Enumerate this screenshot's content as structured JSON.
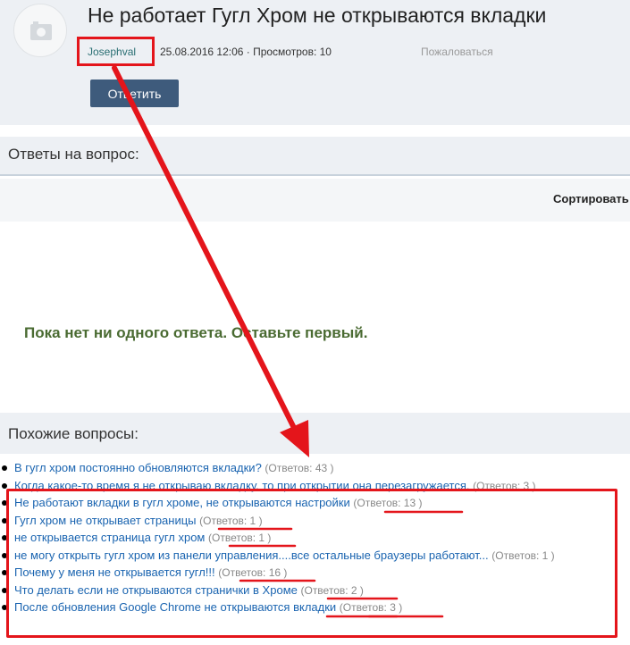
{
  "question": {
    "title": "Не работает Гугл Хром не открываются вкладки",
    "author": "Josephval",
    "meta": "25.08.2016 12:06 · Просмотров: 10",
    "report_label": "Пожаловаться",
    "reply_label": "Ответить",
    "avatar_icon": "camera-icon"
  },
  "answers": {
    "heading": "Ответы на вопрос:",
    "sort_label": "Сортировать",
    "empty_message": "Пока нет ни одного ответа. Оставьте первый."
  },
  "similar": {
    "heading": "Похожие вопросы:",
    "items": [
      {
        "text": "В гугл хром постоянно обновляются вкладки?",
        "count": "(Ответов: 43 )"
      },
      {
        "text": "Когда какое-то время я не открываю вкладку, то при открытии она перезагружается.",
        "count": "(Ответов: 3 )"
      },
      {
        "text": "Не работают вкладки в гугл хроме, не открываются настройки",
        "count": "(Ответов: 13 )"
      },
      {
        "text": "Гугл хром не открывает страницы",
        "count": "(Ответов: 1 )"
      },
      {
        "text": "не открывается страница гугл хром",
        "count": "(Ответов: 1 )"
      },
      {
        "text": "не могу открыть гугл хром из панели управления....все остальные браузеры работают...",
        "count": "(Ответов: 1 )"
      },
      {
        "text": "Почему у меня не открывается гугл!!!",
        "count": "(Ответов: 16 )"
      },
      {
        "text": "Что делать если не открываются странички в Хроме",
        "count": "(Ответов: 2 )"
      },
      {
        "text": "После обновления Google Chrome не открываются вкладки",
        "count": "(Ответов: 3 )"
      }
    ]
  },
  "annotation_color": "#e4151b"
}
